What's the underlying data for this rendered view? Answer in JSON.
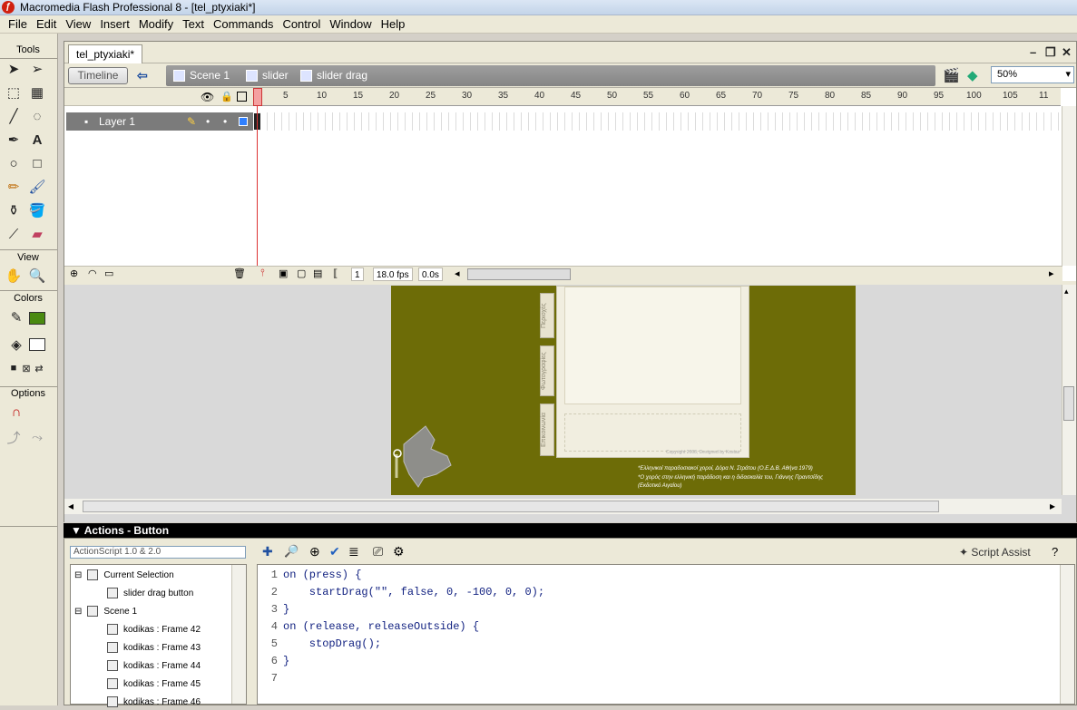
{
  "titlebar": {
    "title": "Macromedia Flash Professional 8 - [tel_ptyxiaki*]"
  },
  "menu": [
    "File",
    "Edit",
    "View",
    "Insert",
    "Modify",
    "Text",
    "Commands",
    "Control",
    "Window",
    "Help"
  ],
  "tools": {
    "title": "Tools",
    "view_label": "View",
    "colors_label": "Colors",
    "options_label": "Options",
    "stroke_color": "#4a8a10",
    "fill_color": "#ffffff"
  },
  "document": {
    "tab": "tel_ptyxiaki*",
    "timeline_label": "Timeline",
    "crumbs": [
      "Scene 1",
      "slider",
      "slider drag"
    ],
    "zoom": "50%"
  },
  "timeline": {
    "layer": "Layer 1",
    "ruler": [
      "5",
      "10",
      "15",
      "20",
      "25",
      "30",
      "35",
      "40",
      "45",
      "50",
      "55",
      "60",
      "65",
      "70",
      "75",
      "80",
      "85",
      "90",
      "95",
      "100",
      "105",
      "11"
    ],
    "frame": "1",
    "fps": "18.0 fps",
    "time": "0.0s"
  },
  "stage": {
    "bg": "#6d6c07",
    "tabs": [
      "Περιοχές",
      "Φωτογραφίες",
      "Επικοινωνία"
    ],
    "credit1": "*Ελληνικοί παραδοσιακοί χοροί, Δόρα Ν. Στράτου (Ο.Ε.Δ.Β. Αθήνα 1979)",
    "credit2": "*Ο χορός στην ελληνική παράδοση και η διδασκαλία του, Γιάννης Πραντσίδης",
    "credit3": "(Εκδοτικό Αιγαίου)",
    "paper_text": "Copyright 2008, Designed by Kostas"
  },
  "actions": {
    "title": "Actions - Button",
    "version": "ActionScript 1.0 & 2.0",
    "script_assist": "Script Assist",
    "tree": [
      "Current Selection",
      "slider drag button",
      "Scene 1",
      "kodikas : Frame 42",
      "kodikas : Frame 43",
      "kodikas : Frame 44",
      "kodikas : Frame 45",
      "kodikas : Frame 46"
    ],
    "line_numbers": [
      "1",
      "2",
      "3",
      "4",
      "5",
      "6",
      "7"
    ],
    "code": [
      "on (press) {",
      "    startDrag(\"\", false, 0, -100, 0, 0);",
      "}",
      "on (release, releaseOutside) {",
      "    stopDrag();",
      "}",
      ""
    ]
  }
}
